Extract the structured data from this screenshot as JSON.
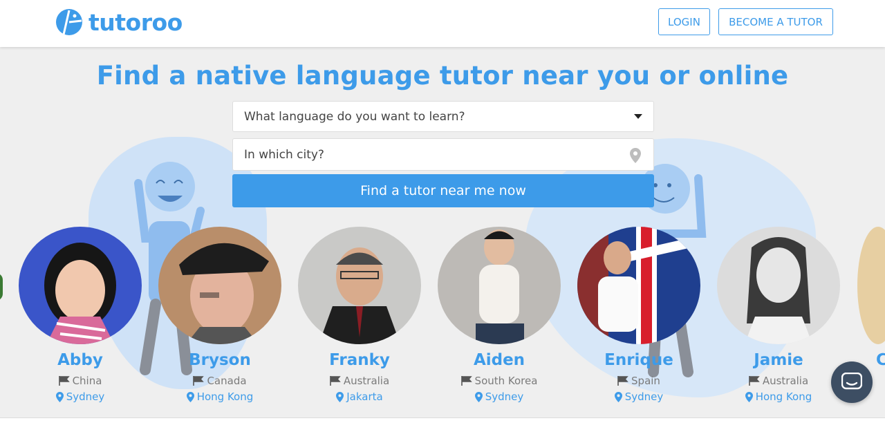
{
  "brand": {
    "name": "tutoroo",
    "color": "#3d9be9"
  },
  "header": {
    "login_label": "LOGIN",
    "become_tutor_label": "BECOME A TUTOR"
  },
  "hero": {
    "headline": "Find a native language tutor near you or online",
    "language_placeholder": "What language do you want to learn?",
    "city_placeholder": "In which city?",
    "cta_label": "Find a tutor near me now"
  },
  "tutors": [
    {
      "name": "Abby",
      "country": "China",
      "city": "Sydney"
    },
    {
      "name": "Bryson",
      "country": "Canada",
      "city": "Hong Kong"
    },
    {
      "name": "Franky",
      "country": "Australia",
      "city": "Jakarta"
    },
    {
      "name": "Aiden",
      "country": "South Korea",
      "city": "Sydney"
    },
    {
      "name": "Enrique",
      "country": "Spain",
      "city": "Sydney"
    },
    {
      "name": "Jamie",
      "country": "Australia",
      "city": "Hong Kong"
    }
  ],
  "peek_tutor_initial": "C",
  "icons": {
    "country": "flag-icon",
    "city": "map-pin-icon",
    "chat": "chat-icon",
    "dropdown": "chevron-down-icon"
  }
}
